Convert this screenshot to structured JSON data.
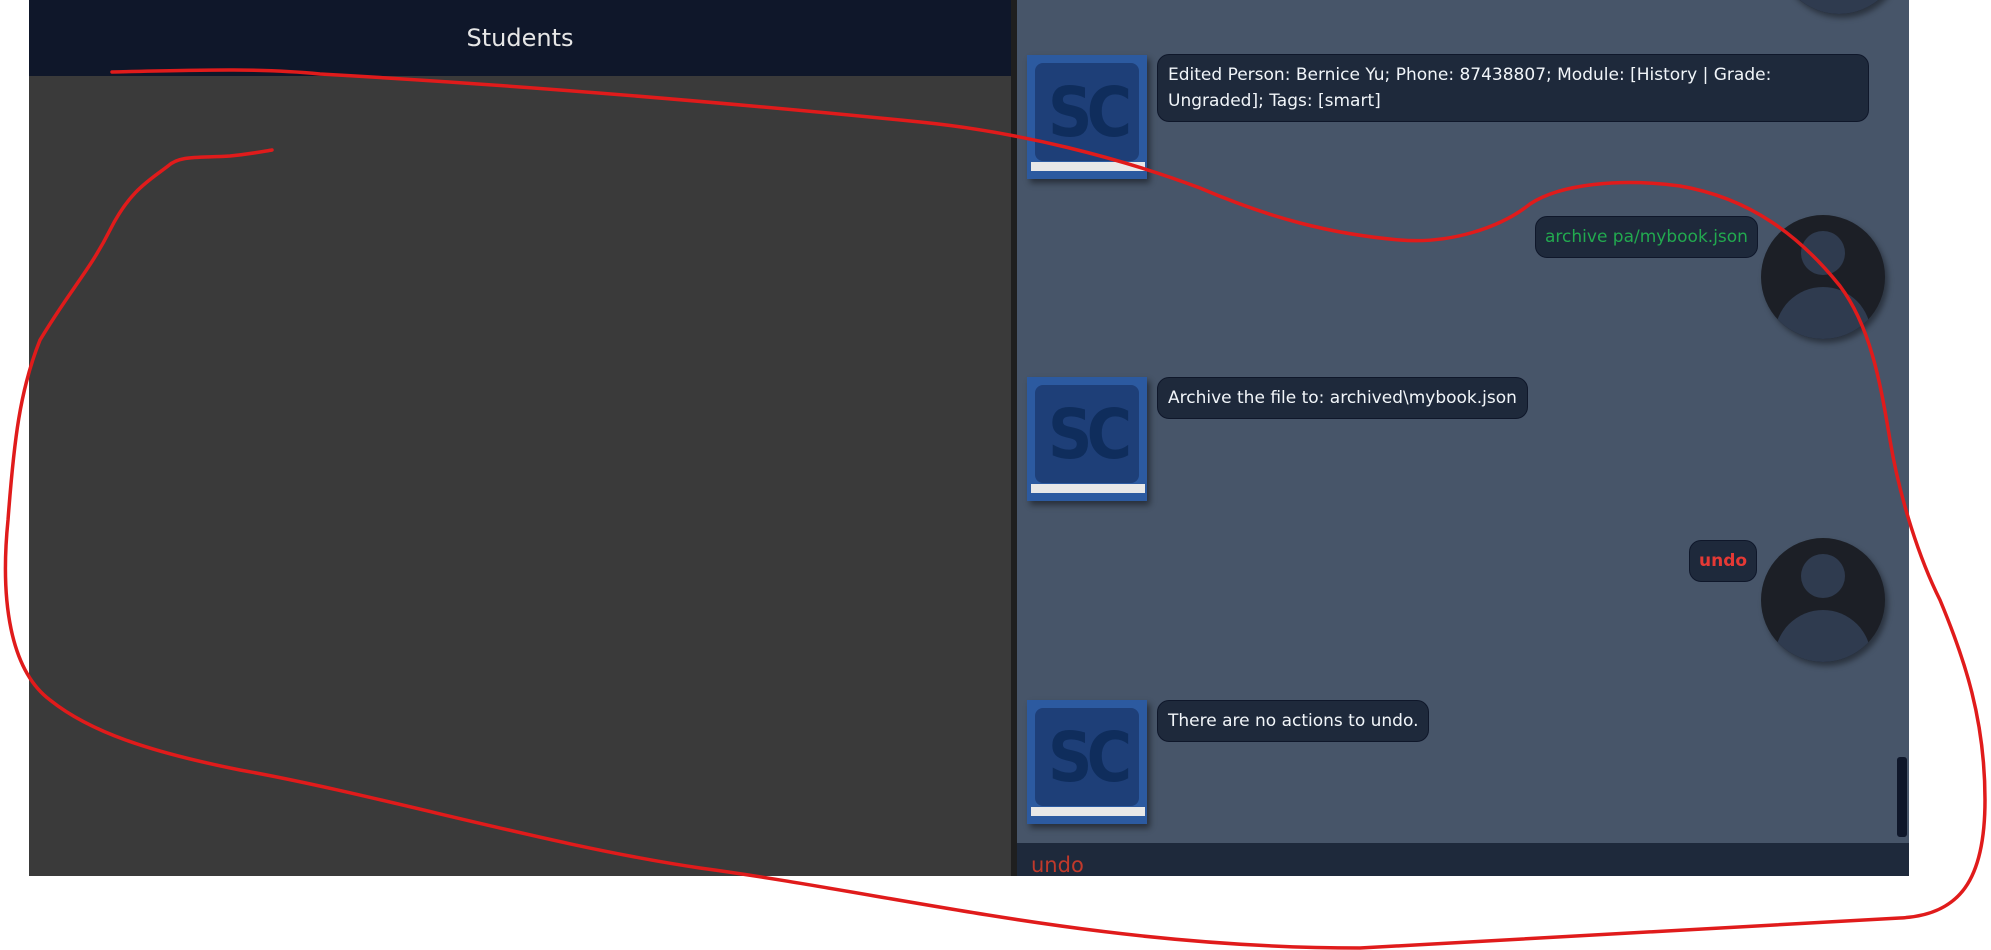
{
  "students_panel": {
    "title": "Students"
  },
  "chat": {
    "messages": [
      {
        "from": "bot",
        "text": "Edited Person: Bernice Yu; Phone: 87438807; Module: [History | Grade: Ungraded]; Tags: [smart]"
      },
      {
        "from": "user",
        "text": "archive pa/mybook.json",
        "color": "#22a94f"
      },
      {
        "from": "bot",
        "text": "Archive the file to: archived\\mybook.json"
      },
      {
        "from": "user",
        "text": "undo",
        "color": "#e53935"
      },
      {
        "from": "bot",
        "text": "There are no actions to undo."
      }
    ],
    "bot_logo": "SC"
  },
  "command_box": {
    "value": "undo"
  },
  "colors": {
    "success_command": "#22a94f",
    "error_command": "#e53935",
    "annotation": "#e01b1b"
  }
}
